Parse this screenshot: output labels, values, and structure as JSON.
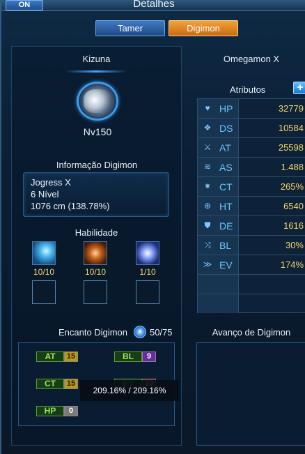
{
  "window": {
    "toggle": "ON",
    "title": "Detalhes"
  },
  "tabs": [
    {
      "label": "Tamer",
      "active": false
    },
    {
      "label": "Digimon",
      "active": true
    }
  ],
  "left": {
    "kizuna": "Kizuna",
    "level": "Nv150",
    "info_title": "Informação Digimon",
    "info_lines": [
      "Jogress X",
      "6 Nível",
      "1076 cm (138.78%)"
    ],
    "skill_title": "Habilidade",
    "skills": [
      {
        "icon": "ice-slash-icon",
        "level": "10/10"
      },
      {
        "icon": "fire-slash-icon",
        "level": "10/10"
      },
      {
        "icon": "lightning-burst-icon",
        "level": "1/10"
      }
    ],
    "enchant_title": "Encanto Digimon",
    "enchant_count": "50/75",
    "enchant_stats": [
      {
        "name": "AT",
        "value": "15",
        "tone": "yellow"
      },
      {
        "name": "BL",
        "value": "9",
        "tone": "purple"
      },
      {
        "name": "CT",
        "value": "15",
        "tone": "yellow"
      },
      {
        "name": "EV",
        "value": "10",
        "tone": "red"
      },
      {
        "name": "HP",
        "value": "0",
        "tone": "gray"
      }
    ],
    "tooltip": "209.16% / 209.16%"
  },
  "right": {
    "digimon_name": "Omegamon X",
    "attributes_title": "Atributos",
    "plus": "+",
    "attributes": [
      {
        "icon": "heart-icon",
        "name": "HP",
        "value": "32779"
      },
      {
        "icon": "digisoul-icon",
        "name": "DS",
        "value": "10584"
      },
      {
        "icon": "sword-icon",
        "name": "AT",
        "value": "25598"
      },
      {
        "icon": "claw-icon",
        "name": "AS",
        "value": "1.488"
      },
      {
        "icon": "critical-burst-icon",
        "name": "CT",
        "value": "265%"
      },
      {
        "icon": "crosshair-icon",
        "name": "HT",
        "value": "6540"
      },
      {
        "icon": "shield-icon",
        "name": "DE",
        "value": "1616"
      },
      {
        "icon": "block-icon",
        "name": "BL",
        "value": "30%"
      },
      {
        "icon": "evade-icon",
        "name": "EV",
        "value": "174%"
      }
    ],
    "advance_title": "Avanço de Digimon"
  }
}
